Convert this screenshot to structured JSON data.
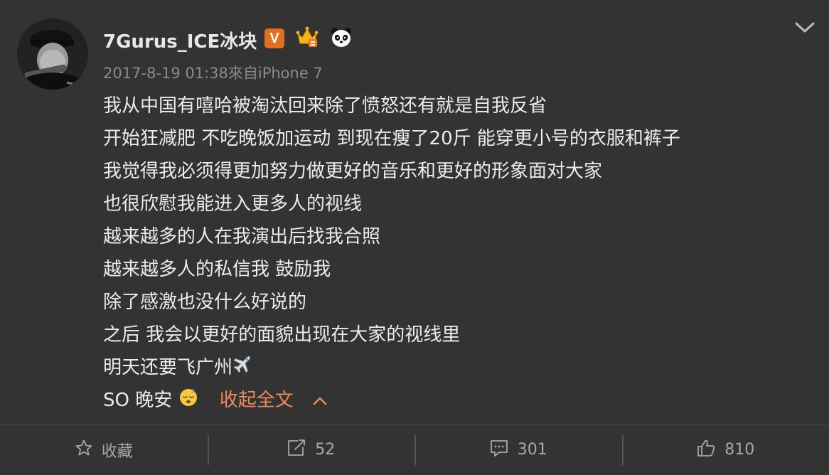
{
  "post": {
    "username": "7Gurus_ICE冰块",
    "badges": [
      "vip-v-icon",
      "crown-icon",
      "panda-icon"
    ],
    "badge_v_text": "V",
    "timestamp": "2017-8-19 01:38",
    "source": "來自iPhone 7",
    "lines": [
      "我从中国有嘻哈被淘汰回来除了愤怒还有就是自我反省",
      "开始狂减肥 不吃晚饭加运动 到现在瘦了20斤 能穿更小号的衣服和裤子",
      "我觉得我必须得更加努力做更好的音乐和更好的形象面对大家",
      "也很欣慰我能进入更多人的视线",
      "越来越多的人在我演出后找我合照",
      "越来越多人的私信我 鼓励我",
      "除了感激也没什么好说的",
      "之后 我会以更好的面貌出现在大家的视线里",
      "明天还要飞广州"
    ],
    "last_line": "SO 晚安",
    "collapse_label": "收起全文",
    "accent_color": "#f0885a"
  },
  "toolbar": {
    "favorite_label": "收藏",
    "repost_count": "52",
    "comment_count": "301",
    "like_count": "810"
  }
}
